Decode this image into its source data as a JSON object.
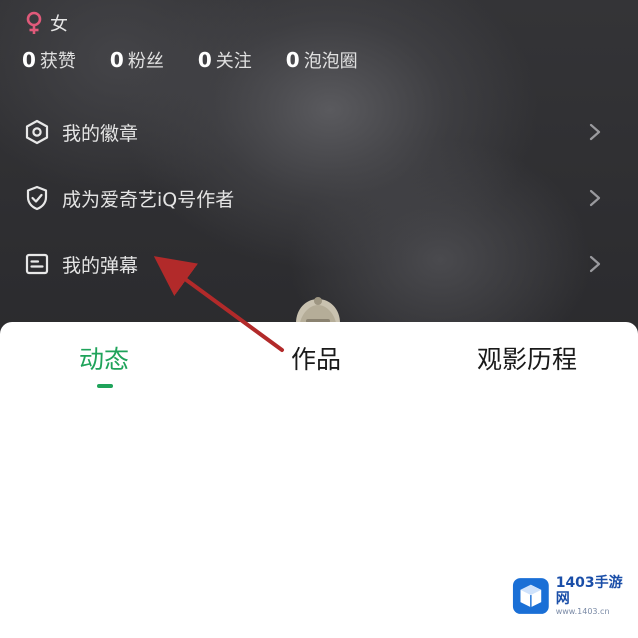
{
  "profile": {
    "gender_label": "女",
    "stats": [
      {
        "value": "0",
        "label": "获赞"
      },
      {
        "value": "0",
        "label": "粉丝"
      },
      {
        "value": "0",
        "label": "关注"
      },
      {
        "value": "0",
        "label": "泡泡圈"
      }
    ]
  },
  "menu": {
    "items": [
      {
        "label": "我的徽章",
        "icon": "badge-icon"
      },
      {
        "label": "成为爱奇艺iQ号作者",
        "icon": "shield-check-icon"
      },
      {
        "label": "我的弹幕",
        "icon": "danmaku-icon"
      }
    ]
  },
  "tabs": [
    {
      "label": "动态",
      "active": true
    },
    {
      "label": "作品",
      "active": false
    },
    {
      "label": "观影历程",
      "active": false
    }
  ],
  "watermark": {
    "title": "1403手游网",
    "subtitle": "www.1403.cn"
  },
  "colors": {
    "accent": "#1fa35a",
    "gender": "#e05a7a",
    "annotation_arrow": "#b22a2a",
    "watermark_blue": "#1a6fd6"
  }
}
